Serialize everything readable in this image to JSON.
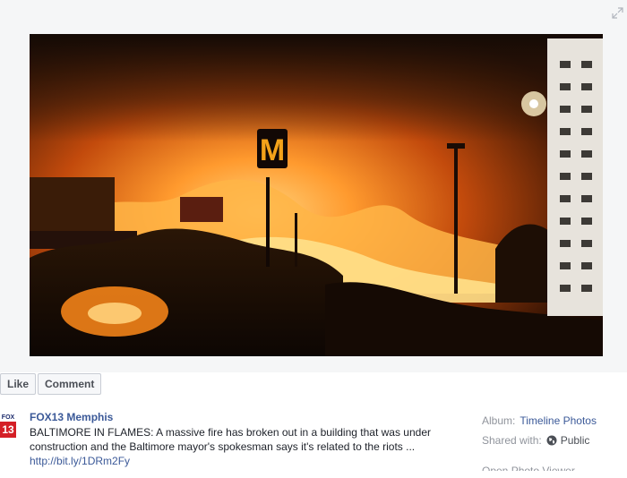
{
  "photo": {
    "sign_letter": "M"
  },
  "actions": {
    "like_label": "Like",
    "comment_label": "Comment"
  },
  "post": {
    "page_avatar_top": "FOX",
    "page_avatar_num": "13",
    "page_name": "FOX13 Memphis",
    "caption": "BALTIMORE IN FLAMES: A massive fire has broken out in a building that was under construction and the Baltimore mayor's spokesman says it's related to the riots ...",
    "link": "http://bit.ly/1DRm2Fy"
  },
  "meta": {
    "album_label": "Album:",
    "album_value": "Timeline Photos",
    "shared_label": "Shared with:",
    "shared_value": "Public",
    "partial_row": "Open Photo Viewer"
  },
  "colors": {
    "link": "#3b5998",
    "muted": "#90949c",
    "fire": "#ff8a1a"
  },
  "icons": {
    "expand": "expand-icon",
    "globe": "globe-icon"
  }
}
